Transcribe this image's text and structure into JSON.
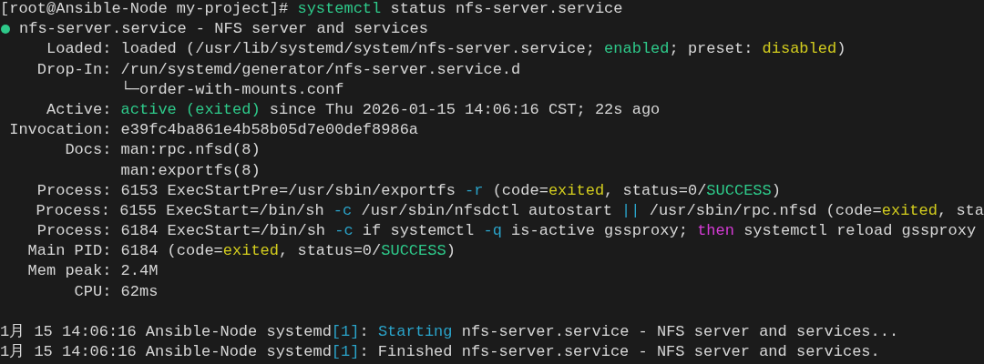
{
  "prompt": {
    "segments": [
      {
        "text": "[root@Ansible-Node my-project]# "
      },
      {
        "text": "systemctl",
        "color": "#2ec98a"
      },
      {
        "text": " status nfs-server.service"
      }
    ]
  },
  "unit": {
    "color": "#2ec98a",
    "title": "nfs-server.service - NFS server and services"
  },
  "fields": [
    {
      "label": "Loaded:",
      "segments": [
        {
          "text": "loaded (/usr/lib/systemd/system/nfs-server.service; "
        },
        {
          "text": "enabled",
          "color": "#2ec98a"
        },
        {
          "text": "; preset: "
        },
        {
          "text": "disabled",
          "color": "#d2cc1e"
        },
        {
          "text": ")"
        }
      ]
    },
    {
      "label": "Drop-In:",
      "segments": [
        {
          "text": "/run/systemd/generator/nfs-server.service.d"
        }
      ]
    },
    {
      "segments": [
        {
          "text": "└─order-with-mounts.conf"
        }
      ]
    },
    {
      "label": "Active:",
      "segments": [
        {
          "text": "active (exited)",
          "color": "#2ec98a"
        },
        {
          "text": " since Thu 2026-01-15 14:06:16 CST; 22s ago"
        }
      ]
    },
    {
      "label": "Invocation:",
      "segments": [
        {
          "text": "e39fc4ba861e4b58b05d7e00def8986a"
        }
      ]
    },
    {
      "label": "Docs:",
      "segments": [
        {
          "text": "man:rpc.nfsd(8)"
        }
      ]
    },
    {
      "segments": [
        {
          "text": "man:exportfs(8)"
        }
      ]
    },
    {
      "label": "Process:",
      "segments": [
        {
          "text": "6153 ExecStartPre=/usr/sbin/exportfs "
        },
        {
          "text": "-r",
          "color": "#2aa3c9"
        },
        {
          "text": " (code="
        },
        {
          "text": "exited",
          "color": "#d2cc1e"
        },
        {
          "text": ", status=0/"
        },
        {
          "text": "SUCCESS",
          "color": "#2ec98a"
        },
        {
          "text": ")"
        }
      ]
    },
    {
      "label": "Process:",
      "segments": [
        {
          "text": "6155 ExecStart=/bin/sh "
        },
        {
          "text": "-c",
          "color": "#2aa3c9"
        },
        {
          "text": " /usr/sbin/nfsdctl autostart "
        },
        {
          "text": "||",
          "color": "#2aa3c9"
        },
        {
          "text": " /usr/sbin/rpc.nfsd (code="
        },
        {
          "text": "exited",
          "color": "#d2cc1e"
        },
        {
          "text": ", sta"
        }
      ]
    },
    {
      "label": "Process:",
      "segments": [
        {
          "text": "6184 ExecStart=/bin/sh "
        },
        {
          "text": "-c",
          "color": "#2aa3c9"
        },
        {
          "text": " if systemctl "
        },
        {
          "text": "-q",
          "color": "#2aa3c9"
        },
        {
          "text": " is-active gssproxy; "
        },
        {
          "text": "then",
          "color": "#d43bd4"
        },
        {
          "text": " systemctl reload gssproxy"
        }
      ]
    },
    {
      "label": "Main PID:",
      "segments": [
        {
          "text": "6184 (code="
        },
        {
          "text": "exited",
          "color": "#d2cc1e"
        },
        {
          "text": ", status=0/"
        },
        {
          "text": "SUCCESS",
          "color": "#2ec98a"
        },
        {
          "text": ")"
        }
      ]
    },
    {
      "label": "Mem peak:",
      "segments": [
        {
          "text": "2.4M"
        }
      ]
    },
    {
      "label": "CPU:",
      "segments": [
        {
          "text": "62ms"
        }
      ]
    }
  ],
  "journal": [
    {
      "segments": [
        {
          "text": "1月 15 14:06:16 Ansible-Node systemd"
        },
        {
          "text": "[1]",
          "color": "#2aa3c9"
        },
        {
          "text": ": "
        },
        {
          "text": "Starting",
          "color": "#2aa3c9"
        },
        {
          "text": " nfs-server.service - NFS server and services..."
        }
      ]
    },
    {
      "segments": [
        {
          "text": "1月 15 14:06:16 Ansible-Node systemd"
        },
        {
          "text": "[1]",
          "color": "#2aa3c9"
        },
        {
          "text": ": Finished nfs-server.service - NFS server and services."
        }
      ]
    }
  ]
}
